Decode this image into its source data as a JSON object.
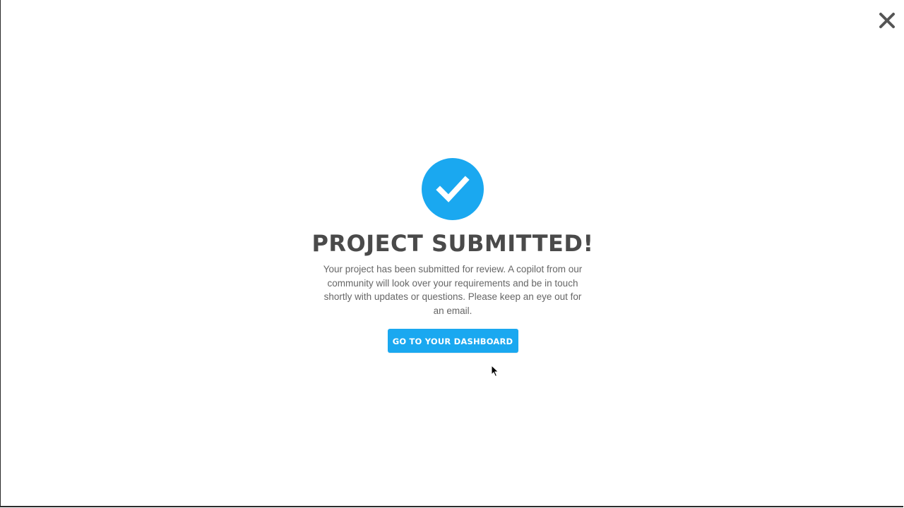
{
  "modal": {
    "title": "PROJECT SUBMITTED!",
    "message": "Your project has been submitted for review. A copilot from our community will look over your requirements and be in touch shortly with updates or questions. Please keep an eye out for an email.",
    "button_label": "GO TO YOUR DASHBOARD",
    "close_icon": "close-icon",
    "success_icon": "checkmark-icon"
  },
  "colors": {
    "accent": "#1aa8f0",
    "title": "#4a4a4a",
    "text": "#666666",
    "close": "#555555"
  }
}
